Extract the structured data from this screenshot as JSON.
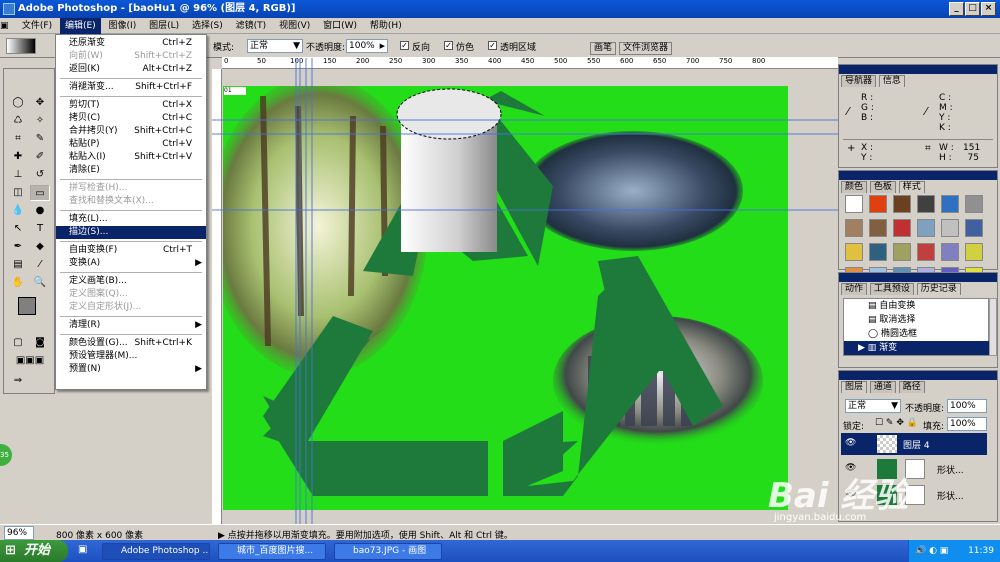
{
  "title": "Adobe Photoshop - [baoHu1 @ 96% (图层 4, RGB)]",
  "menus": [
    "文件(F)",
    "编辑(E)",
    "图像(I)",
    "图层(L)",
    "选择(S)",
    "滤镜(T)",
    "视图(V)",
    "窗口(W)",
    "帮助(H)"
  ],
  "options": {
    "mode_label": "模式:",
    "mode_value": "正常",
    "opacity_label": "不透明度:",
    "opacity_value": "100%",
    "reverse": "反向",
    "dither": "仿色",
    "transparency": "透明区域",
    "tab_brushes": "画笔",
    "tab_filebrowser": "文件浏览器"
  },
  "edit_menu": [
    {
      "label": "还原渐变",
      "shortcut": "Ctrl+Z",
      "disabled": false
    },
    {
      "label": "向前(W)",
      "shortcut": "Shift+Ctrl+Z",
      "disabled": true
    },
    {
      "label": "返回(K)",
      "shortcut": "Alt+Ctrl+Z",
      "disabled": false
    },
    {
      "label": "消褪渐变...",
      "shortcut": "Shift+Ctrl+F",
      "disabled": false
    },
    {
      "label": "剪切(T)",
      "shortcut": "Ctrl+X",
      "disabled": false
    },
    {
      "label": "拷贝(C)",
      "shortcut": "Ctrl+C",
      "disabled": false
    },
    {
      "label": "合并拷贝(Y)",
      "shortcut": "Shift+Ctrl+C",
      "disabled": false
    },
    {
      "label": "粘贴(P)",
      "shortcut": "Ctrl+V",
      "disabled": false
    },
    {
      "label": "粘贴入(I)",
      "shortcut": "Shift+Ctrl+V",
      "disabled": false
    },
    {
      "label": "清除(E)",
      "shortcut": "",
      "disabled": false
    },
    {
      "label": "拼写检查(H)...",
      "shortcut": "",
      "disabled": true
    },
    {
      "label": "查找和替换文本(X)...",
      "shortcut": "",
      "disabled": true
    },
    {
      "label": "填充(L)...",
      "shortcut": "",
      "disabled": false
    },
    {
      "label": "描边(S)...",
      "shortcut": "",
      "disabled": false,
      "highlight": true
    },
    {
      "label": "自由变换(F)",
      "shortcut": "Ctrl+T",
      "disabled": false
    },
    {
      "label": "变换(A)",
      "shortcut": "",
      "disabled": false,
      "submenu": true
    },
    {
      "label": "定义画笔(B)...",
      "shortcut": "",
      "disabled": false
    },
    {
      "label": "定义图案(Q)...",
      "shortcut": "",
      "disabled": true
    },
    {
      "label": "定义自定形状(J)...",
      "shortcut": "",
      "disabled": true
    },
    {
      "label": "清理(R)",
      "shortcut": "",
      "disabled": false,
      "submenu": true
    },
    {
      "label": "颜色设置(G)...",
      "shortcut": "Shift+Ctrl+K",
      "disabled": false
    },
    {
      "label": "预设管理器(M)...",
      "shortcut": "",
      "disabled": false
    },
    {
      "label": "预置(N)",
      "shortcut": "",
      "disabled": false,
      "submenu": true
    }
  ],
  "ruler_ticks": [
    "0",
    "50",
    "100",
    "150",
    "200",
    "250",
    "300",
    "350",
    "400",
    "450",
    "500",
    "550",
    "600",
    "650",
    "700",
    "750",
    "800"
  ],
  "navigator": {
    "tab_nav": "导航器",
    "tab_info": "信息",
    "r": "R :",
    "g": "G :",
    "b": "B :",
    "c": "C :",
    "m": "M :",
    "y": "Y :",
    "k": "K :",
    "x": "X :",
    "y2": "Y :",
    "w": "W :",
    "h": "H :",
    "w_val": "151",
    "h_val": "75"
  },
  "swatches": {
    "tab_color": "颜色",
    "tab_swatches": "色板",
    "tab_styles": "样式"
  },
  "history": {
    "tab_actions": "动作",
    "tab_presets": "工具预设",
    "tab_history": "历史记录",
    "items": [
      "自由变换",
      "取消选择",
      "椭圆选框",
      "渐变"
    ]
  },
  "layers": {
    "tab_layers": "图层",
    "tab_channels": "通道",
    "tab_paths": "路径",
    "blend": "正常",
    "opacity_label": "不透明度:",
    "opacity_value": "100%",
    "lock_label": "锁定:",
    "fill_label": "填充:",
    "fill_value": "100%",
    "rows": [
      "图层 4",
      "形状...",
      "形状..."
    ]
  },
  "status": {
    "zoom": "96%",
    "size": "800 像素 x 600 像素",
    "hint": "▶ 点按并拖移以用渐变填充。要用附加选项，使用 Shift、Alt 和 Ctrl 键。"
  },
  "taskbar": {
    "start": "开始",
    "tasks": [
      "Adobe Photoshop ...",
      "城市_百度图片搜...",
      "bao73.JPG - 画图"
    ],
    "time": "11:39"
  },
  "canvas_tag": "01",
  "watermark": "Bai 经验",
  "watermark_sub": "jingyan.baidu.com",
  "badge": "35"
}
